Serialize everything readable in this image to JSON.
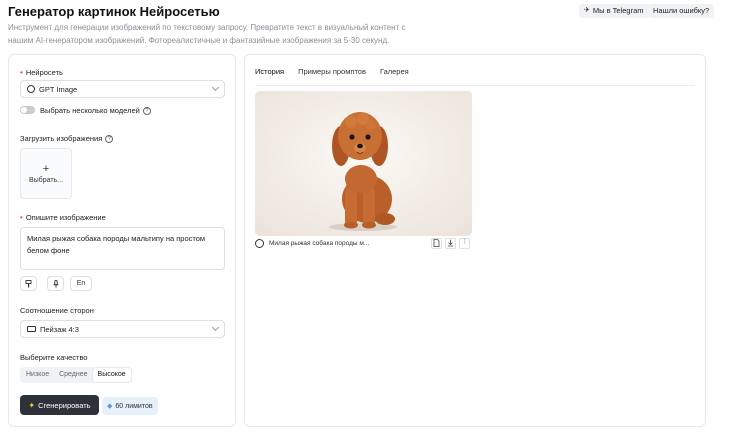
{
  "header": {
    "title": "Генератор картинок Нейросетью",
    "description": "Инструмент для генерации изображений по текстовому запросу. Превратите текст в визуальный контент с нашим AI-генератором изображений. Фотореалистичные и фантазийные изображения за 5-30 секунд.",
    "telegram_label": "Мы в Telegram",
    "report_label": "Нашли ошибку?"
  },
  "form": {
    "model_label": "Нейросеть",
    "model_value": "GPT Image",
    "multi_models_label": "Выбрать несколько моделей",
    "upload_label": "Загрузить изображения",
    "upload_button": "Выбрать...",
    "describe_label": "Опишите изображение",
    "prompt_value": "Милая рыжая собака породы мальтипу на простом белом фоне",
    "lang_button": "En",
    "aspect_label": "Соотношение сторон",
    "aspect_value": "Пейзаж 4:3",
    "quality_label": "Выберите качество",
    "quality_options": [
      "Низкое",
      "Среднее",
      "Высокое"
    ],
    "quality_selected": "Высокое",
    "generate_button": "Сгенерировать",
    "limits_label": "60 лимитов"
  },
  "results": {
    "tabs": [
      "История",
      "Примеры промптов",
      "Галерея"
    ],
    "active_tab": "История",
    "card_caption": "Милая рыжая собака породы м...",
    "icons": [
      "document-icon",
      "download-icon",
      "more-icon"
    ]
  },
  "colors": {
    "accent_dark": "#2c313a",
    "required_red": "#e5483f",
    "limits_bg": "#e6f0fb",
    "dog_fur": "#c2662e"
  }
}
